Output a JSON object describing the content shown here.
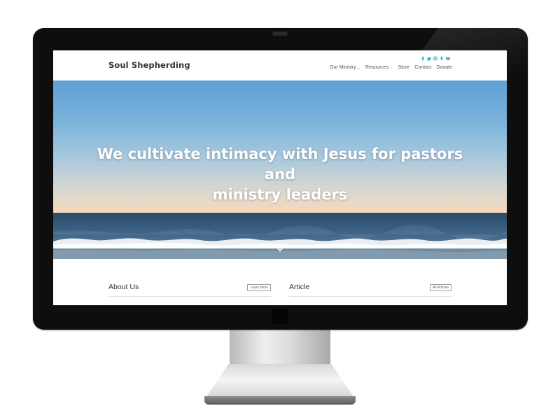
{
  "site": {
    "logo": "Soul Shepherding",
    "social_icons": [
      "facebook-icon",
      "twitter-icon",
      "instagram-icon",
      "podcast-icon",
      "youtube-icon"
    ],
    "accent_color": "#1da1c9"
  },
  "nav": {
    "items": [
      {
        "label": "Our Ministry",
        "has_dropdown": true
      },
      {
        "label": "Resources",
        "has_dropdown": true
      },
      {
        "label": "Store",
        "has_dropdown": false
      },
      {
        "label": "Contact",
        "has_dropdown": false
      },
      {
        "label": "Donate",
        "has_dropdown": false
      }
    ],
    "caret": "⌄"
  },
  "hero": {
    "headline_line1": "We cultivate intimacy with Jesus for pastors and",
    "headline_line2": "ministry leaders",
    "scroll_icon": "chevron-down-icon"
  },
  "sections": [
    {
      "title": "About Us",
      "button": "Learn More"
    },
    {
      "title": "Article",
      "button": "All Articles"
    }
  ]
}
